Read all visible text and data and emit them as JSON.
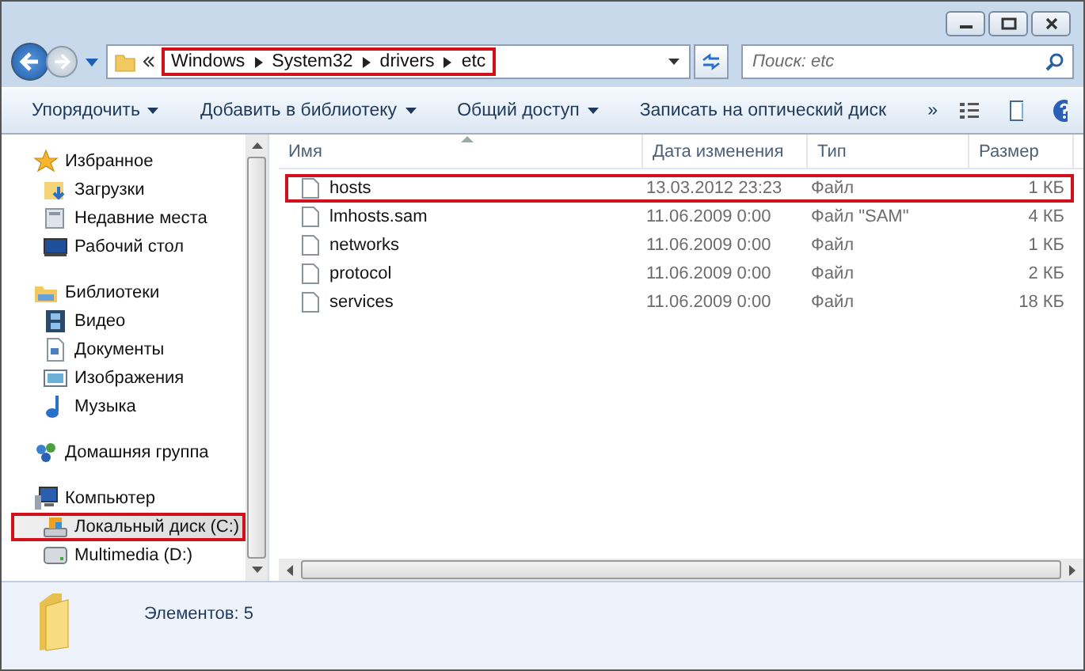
{
  "address": {
    "breadcrumb": [
      "Windows",
      "System32",
      "drivers",
      "etc"
    ],
    "highlighted": true
  },
  "search": {
    "placeholder": "Поиск: etc"
  },
  "toolbar": {
    "items": [
      {
        "label": "Упорядочить",
        "dropdown": true
      },
      {
        "label": "Добавить в библиотеку",
        "dropdown": true
      },
      {
        "label": "Общий доступ",
        "dropdown": true
      },
      {
        "label": "Записать на оптический диск",
        "dropdown": false
      }
    ],
    "overflow": "»"
  },
  "sidebar": {
    "groups": [
      {
        "label": "Избранное",
        "kind": "star",
        "children": [
          {
            "label": "Загрузки",
            "kind": "downloads",
            "selected": false,
            "highlighted": false
          },
          {
            "label": "Недавние места",
            "kind": "recent",
            "selected": false,
            "highlighted": false
          },
          {
            "label": "Рабочий стол",
            "kind": "desktop",
            "selected": false,
            "highlighted": false
          }
        ]
      },
      {
        "label": "Библиотеки",
        "kind": "library",
        "children": [
          {
            "label": "Видео",
            "kind": "video",
            "selected": false,
            "highlighted": false
          },
          {
            "label": "Документы",
            "kind": "documents",
            "selected": false,
            "highlighted": false
          },
          {
            "label": "Изображения",
            "kind": "pictures",
            "selected": false,
            "highlighted": false
          },
          {
            "label": "Музыка",
            "kind": "music",
            "selected": false,
            "highlighted": false
          }
        ]
      },
      {
        "label": "Домашняя группа",
        "kind": "homegroup"
      },
      {
        "label": "Компьютер",
        "kind": "computer",
        "children": [
          {
            "label": "Локальный диск (C:)",
            "kind": "disk",
            "selected": true,
            "highlighted": true
          },
          {
            "label": "Multimedia (D:)",
            "kind": "drive",
            "selected": false,
            "highlighted": false
          }
        ]
      }
    ]
  },
  "table": {
    "columns": [
      {
        "label": "Имя",
        "sorted": true
      },
      {
        "label": "Дата изменения",
        "sorted": false
      },
      {
        "label": "Тип",
        "sorted": false
      },
      {
        "label": "Размер",
        "sorted": false
      }
    ],
    "rows": [
      {
        "name": "hosts",
        "date": "13.03.2012 23:23",
        "type": "Файл",
        "size": "1 КБ",
        "highlighted": true
      },
      {
        "name": "lmhosts.sam",
        "date": "11.06.2009 0:00",
        "type": "Файл \"SAM\"",
        "size": "4 КБ",
        "highlighted": false
      },
      {
        "name": "networks",
        "date": "11.06.2009 0:00",
        "type": "Файл",
        "size": "1 КБ",
        "highlighted": false
      },
      {
        "name": "protocol",
        "date": "11.06.2009 0:00",
        "type": "Файл",
        "size": "2 КБ",
        "highlighted": false
      },
      {
        "name": "services",
        "date": "11.06.2009 0:00",
        "type": "Файл",
        "size": "18 КБ",
        "highlighted": false
      }
    ]
  },
  "status_bar": {
    "text": "Элементов: 5"
  }
}
